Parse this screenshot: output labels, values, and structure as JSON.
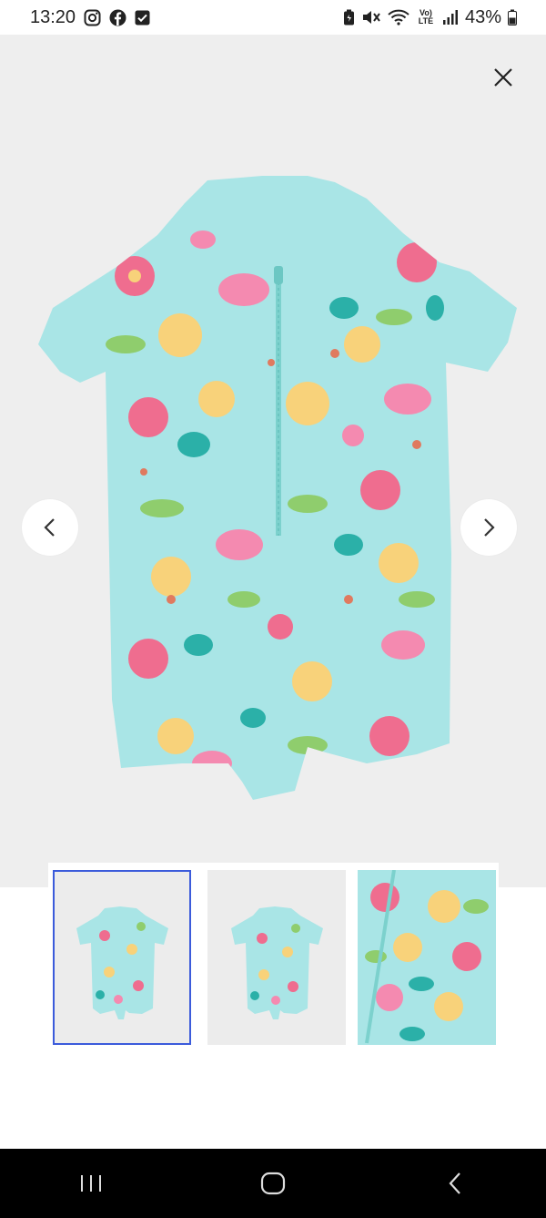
{
  "status_bar": {
    "time": "13:20",
    "battery_percent": "43%",
    "network_label": "Vo) LTE",
    "icons": [
      "instagram-icon",
      "facebook-icon",
      "checkbox-notification-icon",
      "battery-saver-icon",
      "mute-icon",
      "wifi-icon",
      "signal-icon",
      "battery-icon"
    ]
  },
  "gallery": {
    "close_icon": "close-icon",
    "prev_icon": "chevron-left-icon",
    "next_icon": "chevron-right-icon",
    "product_colors": {
      "fabric": "#a9e5e6",
      "flower_pink": "#ef6d8f",
      "flower_yellow": "#f8d27a",
      "leaf_green": "#8fcd6d",
      "flamingo": "#f48ab0",
      "teal": "#2bb0a8"
    }
  },
  "thumbnails": {
    "count": 3,
    "active_index": 0
  },
  "system_nav": {
    "icons": [
      "recent-apps-icon",
      "home-icon",
      "back-icon"
    ]
  }
}
